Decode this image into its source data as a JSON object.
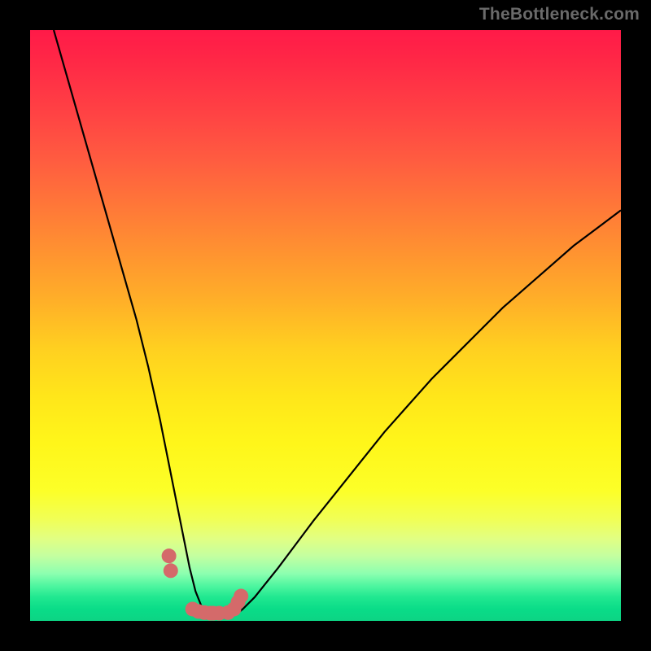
{
  "attribution": "TheBottleneck.com",
  "chart_data": {
    "type": "line",
    "title": "",
    "xlabel": "",
    "ylabel": "",
    "xlim": [
      0,
      100
    ],
    "ylim": [
      0,
      100
    ],
    "series": [
      {
        "name": "bottleneck-curve",
        "x": [
          4,
          6,
          8,
          10,
          12,
          14,
          16,
          18,
          20,
          22,
          23,
          24,
          25,
          26,
          27,
          28,
          29,
          30,
          31,
          32,
          33,
          34,
          35,
          36,
          38,
          40,
          42,
          45,
          48,
          52,
          56,
          60,
          64,
          68,
          72,
          76,
          80,
          84,
          88,
          92,
          96,
          100
        ],
        "values": [
          100,
          93,
          86,
          79,
          72,
          65,
          58,
          51,
          43,
          34,
          29,
          24,
          19,
          14,
          9,
          5,
          2.5,
          1.2,
          0.7,
          0.5,
          0.5,
          0.7,
          1.2,
          2,
          4,
          6.5,
          9,
          13,
          17,
          22,
          27,
          32,
          36.5,
          41,
          45,
          49,
          53,
          56.5,
          60,
          63.5,
          66.5,
          69.5
        ]
      },
      {
        "name": "data-dots",
        "x": [
          23.5,
          23.8,
          27.5,
          28.5,
          29.5,
          30.5,
          31.0,
          32.0,
          33.5,
          34.5,
          35.2,
          35.7
        ],
        "values": [
          11,
          8.5,
          2.0,
          1.6,
          1.4,
          1.3,
          1.3,
          1.3,
          1.4,
          2.0,
          3.2,
          4.2
        ]
      }
    ],
    "colors": {
      "gradient_top": "#ff1a48",
      "gradient_bottom": "#0cd484",
      "curve": "#000000",
      "dots": "#d46a6a",
      "background": "#000000",
      "attribution": "#6a6a6a"
    }
  }
}
